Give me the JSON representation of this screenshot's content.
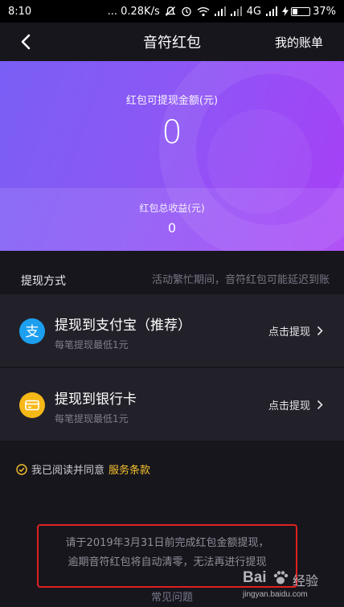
{
  "status_bar": {
    "time": "8:10",
    "network_speed": "... 0.28K/s",
    "network_type": "4G",
    "battery_percent": "37%",
    "battery_level": 0.37
  },
  "header": {
    "title": "音符红包",
    "right_link": "我的账单"
  },
  "hero": {
    "withdrawable_label": "红包可提现金额(元)",
    "withdrawable_amount": "0",
    "total_label": "红包总收益(元)",
    "total_amount": "0"
  },
  "withdraw_section": {
    "title": "提现方式",
    "note": "活动繁忙期间，音符红包可能延迟到账"
  },
  "options": [
    {
      "icon": "alipay-icon",
      "title": "提现到支付宝（推荐）",
      "subtitle": "每笔提现最低1元",
      "action": "点击提现"
    },
    {
      "icon": "bank-card-icon",
      "title": "提现到银行卡",
      "subtitle": "每笔提现最低1元",
      "action": "点击提现"
    }
  ],
  "agreement": {
    "text": "我已阅读并同意",
    "link": "服务条款"
  },
  "notice": {
    "line1": "请于2019年3月31日前完成红包金额提现，",
    "line2": "逾期音符红包将自动清零，无法再进行提现"
  },
  "faq": "常见问题",
  "watermark": {
    "brand": "Bai",
    "brand2": "经验",
    "url": "jingyan.baidu.com"
  },
  "colors": {
    "accent": "#f5c12c",
    "gradient_start": "#7a5ff5",
    "gradient_end": "#a73ff7",
    "notice_border": "#e02020"
  }
}
